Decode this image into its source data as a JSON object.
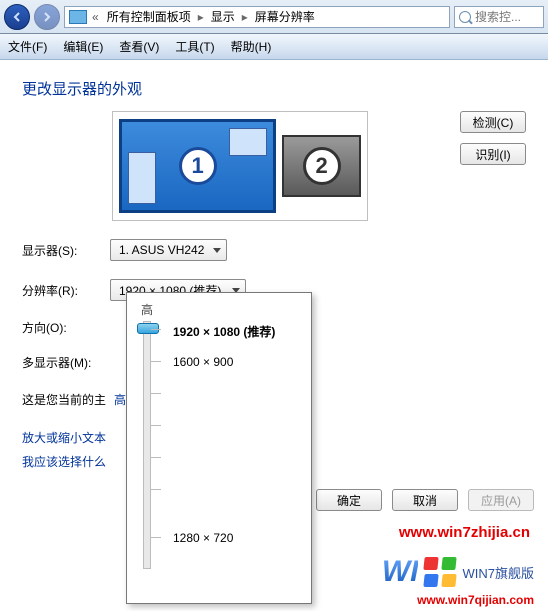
{
  "breadcrumb": {
    "item1": "所有控制面板项",
    "item2": "显示",
    "item3": "屏幕分辨率"
  },
  "search": {
    "placeholder": "搜索控..."
  },
  "menu": {
    "file": "文件(F)",
    "edit": "编辑(E)",
    "view": "查看(V)",
    "tools": "工具(T)",
    "help": "帮助(H)"
  },
  "page": {
    "title": "更改显示器的外观",
    "detect_btn": "检测(C)",
    "identify_btn": "识别(I)",
    "monitors": {
      "m1": "1",
      "m2": "2"
    }
  },
  "fields": {
    "display_label": "显示器(S):",
    "display_value": "1. ASUS VH242",
    "resolution_label": "分辨率(R):",
    "resolution_value": "1920 × 1080 (推荐)",
    "orientation_label": "方向(O):",
    "multi_label": "多显示器(M):"
  },
  "current_line_prefix": "这是您当前的主",
  "adv_link": "高级设置",
  "links": {
    "zoom": "放大或缩小文本",
    "which": "我应该选择什么"
  },
  "buttons": {
    "ok": "确定",
    "cancel": "取消",
    "apply": "应用(A)"
  },
  "res_popup": {
    "top_label": "高",
    "opt_1080": "1920 × 1080 (推荐)",
    "opt_900": "1600 × 900",
    "opt_720": "1280 × 720"
  },
  "watermarks": {
    "url1": "www.win7zhijia.cn",
    "logo": "WI",
    "brand": "WIN7旗舰版",
    "url2": "www.win7qijian.com"
  }
}
